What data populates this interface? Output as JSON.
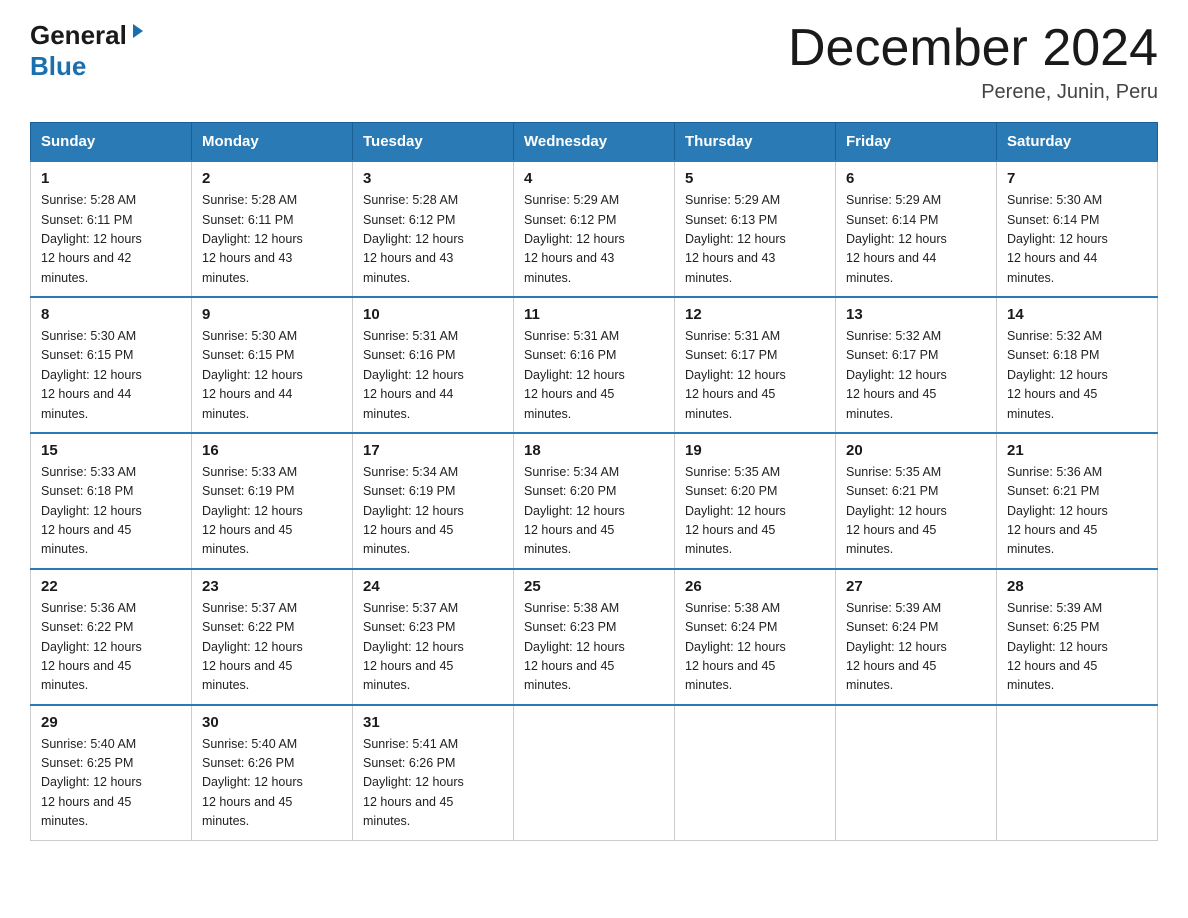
{
  "logo": {
    "general": "General",
    "blue": "Blue"
  },
  "header": {
    "title": "December 2024",
    "subtitle": "Perene, Junin, Peru"
  },
  "days_of_week": [
    "Sunday",
    "Monday",
    "Tuesday",
    "Wednesday",
    "Thursday",
    "Friday",
    "Saturday"
  ],
  "weeks": [
    [
      {
        "day": "1",
        "sunrise": "5:28 AM",
        "sunset": "6:11 PM",
        "daylight": "12 hours and 42 minutes."
      },
      {
        "day": "2",
        "sunrise": "5:28 AM",
        "sunset": "6:11 PM",
        "daylight": "12 hours and 43 minutes."
      },
      {
        "day": "3",
        "sunrise": "5:28 AM",
        "sunset": "6:12 PM",
        "daylight": "12 hours and 43 minutes."
      },
      {
        "day": "4",
        "sunrise": "5:29 AM",
        "sunset": "6:12 PM",
        "daylight": "12 hours and 43 minutes."
      },
      {
        "day": "5",
        "sunrise": "5:29 AM",
        "sunset": "6:13 PM",
        "daylight": "12 hours and 43 minutes."
      },
      {
        "day": "6",
        "sunrise": "5:29 AM",
        "sunset": "6:14 PM",
        "daylight": "12 hours and 44 minutes."
      },
      {
        "day": "7",
        "sunrise": "5:30 AM",
        "sunset": "6:14 PM",
        "daylight": "12 hours and 44 minutes."
      }
    ],
    [
      {
        "day": "8",
        "sunrise": "5:30 AM",
        "sunset": "6:15 PM",
        "daylight": "12 hours and 44 minutes."
      },
      {
        "day": "9",
        "sunrise": "5:30 AM",
        "sunset": "6:15 PM",
        "daylight": "12 hours and 44 minutes."
      },
      {
        "day": "10",
        "sunrise": "5:31 AM",
        "sunset": "6:16 PM",
        "daylight": "12 hours and 44 minutes."
      },
      {
        "day": "11",
        "sunrise": "5:31 AM",
        "sunset": "6:16 PM",
        "daylight": "12 hours and 45 minutes."
      },
      {
        "day": "12",
        "sunrise": "5:31 AM",
        "sunset": "6:17 PM",
        "daylight": "12 hours and 45 minutes."
      },
      {
        "day": "13",
        "sunrise": "5:32 AM",
        "sunset": "6:17 PM",
        "daylight": "12 hours and 45 minutes."
      },
      {
        "day": "14",
        "sunrise": "5:32 AM",
        "sunset": "6:18 PM",
        "daylight": "12 hours and 45 minutes."
      }
    ],
    [
      {
        "day": "15",
        "sunrise": "5:33 AM",
        "sunset": "6:18 PM",
        "daylight": "12 hours and 45 minutes."
      },
      {
        "day": "16",
        "sunrise": "5:33 AM",
        "sunset": "6:19 PM",
        "daylight": "12 hours and 45 minutes."
      },
      {
        "day": "17",
        "sunrise": "5:34 AM",
        "sunset": "6:19 PM",
        "daylight": "12 hours and 45 minutes."
      },
      {
        "day": "18",
        "sunrise": "5:34 AM",
        "sunset": "6:20 PM",
        "daylight": "12 hours and 45 minutes."
      },
      {
        "day": "19",
        "sunrise": "5:35 AM",
        "sunset": "6:20 PM",
        "daylight": "12 hours and 45 minutes."
      },
      {
        "day": "20",
        "sunrise": "5:35 AM",
        "sunset": "6:21 PM",
        "daylight": "12 hours and 45 minutes."
      },
      {
        "day": "21",
        "sunrise": "5:36 AM",
        "sunset": "6:21 PM",
        "daylight": "12 hours and 45 minutes."
      }
    ],
    [
      {
        "day": "22",
        "sunrise": "5:36 AM",
        "sunset": "6:22 PM",
        "daylight": "12 hours and 45 minutes."
      },
      {
        "day": "23",
        "sunrise": "5:37 AM",
        "sunset": "6:22 PM",
        "daylight": "12 hours and 45 minutes."
      },
      {
        "day": "24",
        "sunrise": "5:37 AM",
        "sunset": "6:23 PM",
        "daylight": "12 hours and 45 minutes."
      },
      {
        "day": "25",
        "sunrise": "5:38 AM",
        "sunset": "6:23 PM",
        "daylight": "12 hours and 45 minutes."
      },
      {
        "day": "26",
        "sunrise": "5:38 AM",
        "sunset": "6:24 PM",
        "daylight": "12 hours and 45 minutes."
      },
      {
        "day": "27",
        "sunrise": "5:39 AM",
        "sunset": "6:24 PM",
        "daylight": "12 hours and 45 minutes."
      },
      {
        "day": "28",
        "sunrise": "5:39 AM",
        "sunset": "6:25 PM",
        "daylight": "12 hours and 45 minutes."
      }
    ],
    [
      {
        "day": "29",
        "sunrise": "5:40 AM",
        "sunset": "6:25 PM",
        "daylight": "12 hours and 45 minutes."
      },
      {
        "day": "30",
        "sunrise": "5:40 AM",
        "sunset": "6:26 PM",
        "daylight": "12 hours and 45 minutes."
      },
      {
        "day": "31",
        "sunrise": "5:41 AM",
        "sunset": "6:26 PM",
        "daylight": "12 hours and 45 minutes."
      },
      null,
      null,
      null,
      null
    ]
  ]
}
